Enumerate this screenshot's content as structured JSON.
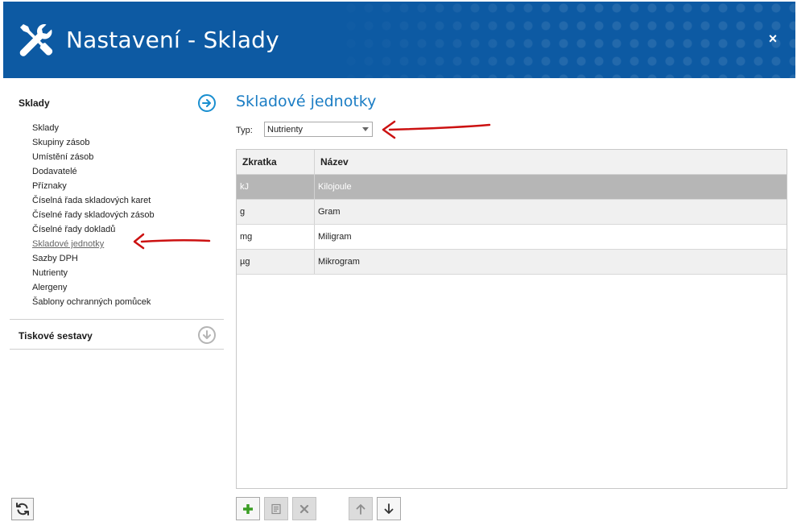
{
  "window": {
    "title": "Nastavení - Sklady",
    "close_label": "×"
  },
  "sidebar": {
    "section1_label": "Sklady",
    "items": [
      {
        "label": "Sklady"
      },
      {
        "label": "Skupiny zásob"
      },
      {
        "label": "Umístění zásob"
      },
      {
        "label": "Dodavatelé"
      },
      {
        "label": "Příznaky"
      },
      {
        "label": "Číselná řada skladových karet"
      },
      {
        "label": "Číselné řady skladových zásob"
      },
      {
        "label": "Číselné řady dokladů"
      },
      {
        "label": "Skladové jednotky"
      },
      {
        "label": "Sazby DPH"
      },
      {
        "label": "Nutrienty"
      },
      {
        "label": "Alergeny"
      },
      {
        "label": "Šablony ochranných pomůcek"
      }
    ],
    "section2_label": "Tiskové sestavy"
  },
  "main": {
    "title": "Skladové jednotky",
    "type_label": "Typ:",
    "type_value": "Nutrienty",
    "table": {
      "headers": [
        "Zkratka",
        "Název"
      ],
      "rows": [
        [
          "kJ",
          "Kilojoule"
        ],
        [
          "g",
          "Gram"
        ],
        [
          "mg",
          "Miligram"
        ],
        [
          "µg",
          "Mikrogram"
        ]
      ]
    }
  },
  "colors": {
    "header_bg": "#0d5aa3",
    "accent": "#1b7dc4",
    "annotation_arrow": "#cc1111",
    "selected_row": "#b6b6b6"
  },
  "icons": [
    "tools-icon",
    "close-icon",
    "arrow-right-circle-icon",
    "arrow-down-circle-icon",
    "refresh-icon",
    "chevron-down-icon",
    "add-icon",
    "edit-icon",
    "delete-icon",
    "move-up-icon",
    "move-down-icon"
  ]
}
